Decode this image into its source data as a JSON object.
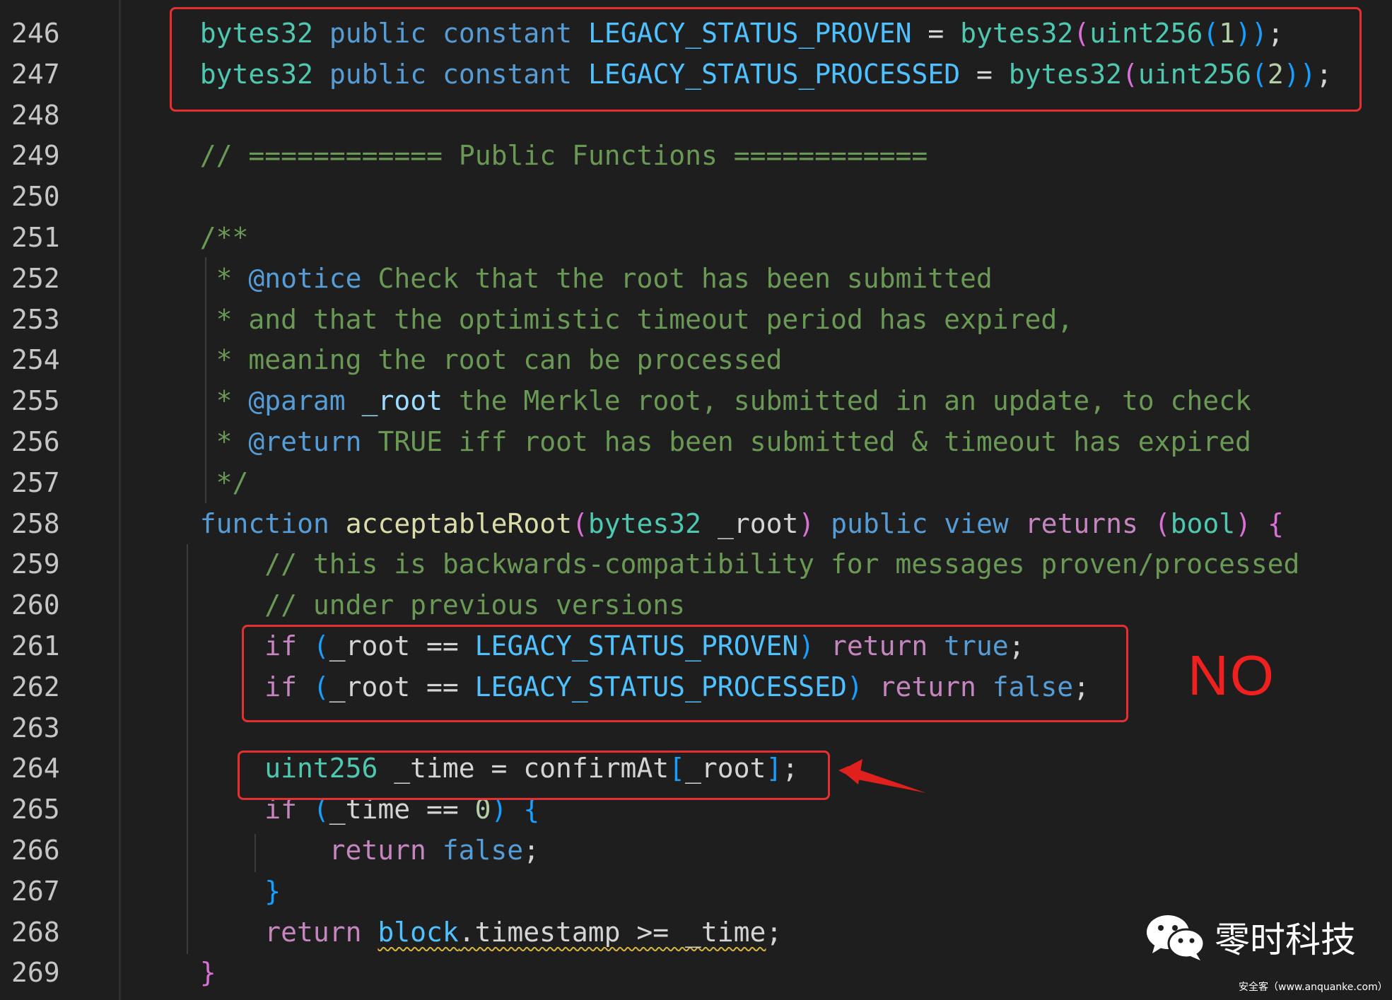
{
  "editor": {
    "lines": [
      {
        "num": "246",
        "indent": 8,
        "guide": false,
        "tokens": [
          [
            "bytes32",
            "#4ec9b0"
          ],
          [
            " ",
            "#d4d4d4"
          ],
          [
            "public",
            "#569cd6"
          ],
          [
            " ",
            "#d4d4d4"
          ],
          [
            "constant",
            "#569cd6"
          ],
          [
            " ",
            "#d4d4d4"
          ],
          [
            "LEGACY_STATUS_PROVEN",
            "#4fc1ff"
          ],
          [
            " = ",
            "#d4d4d4"
          ],
          [
            "bytes32",
            "#4ec9b0"
          ],
          [
            "(",
            "#da70d6"
          ],
          [
            "uint256",
            "#4ec9b0"
          ],
          [
            "(",
            "#179fff"
          ],
          [
            "1",
            "#b5cea8"
          ],
          [
            "))",
            "#179fff"
          ],
          [
            ";",
            "#d4d4d4"
          ]
        ]
      },
      {
        "num": "247",
        "indent": 8,
        "guide": false,
        "tokens": [
          [
            "bytes32",
            "#4ec9b0"
          ],
          [
            " ",
            "#d4d4d4"
          ],
          [
            "public",
            "#569cd6"
          ],
          [
            " ",
            "#d4d4d4"
          ],
          [
            "constant",
            "#569cd6"
          ],
          [
            " ",
            "#d4d4d4"
          ],
          [
            "LEGACY_STATUS_PROCESSED",
            "#4fc1ff"
          ],
          [
            " = ",
            "#d4d4d4"
          ],
          [
            "bytes32",
            "#4ec9b0"
          ],
          [
            "(",
            "#da70d6"
          ],
          [
            "uint256",
            "#4ec9b0"
          ],
          [
            "(",
            "#179fff"
          ],
          [
            "2",
            "#b5cea8"
          ],
          [
            "))",
            "#179fff"
          ],
          [
            ";",
            "#d4d4d4"
          ]
        ]
      },
      {
        "num": "248",
        "indent": 8,
        "guide": false,
        "tokens": []
      },
      {
        "num": "249",
        "indent": 8,
        "guide": false,
        "tokens": [
          [
            "// ============ Public Functions ============",
            "#6a9955"
          ]
        ]
      },
      {
        "num": "250",
        "indent": 8,
        "guide": false,
        "tokens": []
      },
      {
        "num": "251",
        "indent": 8,
        "guide": false,
        "tokens": [
          [
            "/**",
            "#6a9955"
          ]
        ]
      },
      {
        "num": "252",
        "indent": 9,
        "guide": false,
        "tokens": [
          [
            "* ",
            "#6a9955"
          ],
          [
            "@notice",
            "#569cd6"
          ],
          [
            " Check that the root has been submitted",
            "#6a9955"
          ]
        ]
      },
      {
        "num": "253",
        "indent": 9,
        "guide": false,
        "tokens": [
          [
            "* and that the optimistic timeout period has expired,",
            "#6a9955"
          ]
        ]
      },
      {
        "num": "254",
        "indent": 9,
        "guide": false,
        "tokens": [
          [
            "* meaning the root can be processed",
            "#6a9955"
          ]
        ]
      },
      {
        "num": "255",
        "indent": 9,
        "guide": false,
        "tokens": [
          [
            "* ",
            "#6a9955"
          ],
          [
            "@param",
            "#569cd6"
          ],
          [
            " ",
            "#6a9955"
          ],
          [
            "_root",
            "#9cdcfe"
          ],
          [
            " the Merkle root, submitted in an update, to check",
            "#6a9955"
          ]
        ]
      },
      {
        "num": "256",
        "indent": 9,
        "guide": false,
        "tokens": [
          [
            "* ",
            "#6a9955"
          ],
          [
            "@return",
            "#569cd6"
          ],
          [
            " TRUE iff root has been submitted & timeout has expired",
            "#6a9955"
          ]
        ]
      },
      {
        "num": "257",
        "indent": 9,
        "guide": false,
        "tokens": [
          [
            "*/",
            "#6a9955"
          ]
        ]
      },
      {
        "num": "258",
        "indent": 8,
        "guide": false,
        "tokens": [
          [
            "function",
            "#569cd6"
          ],
          [
            " ",
            "#d4d4d4"
          ],
          [
            "acceptableRoot",
            "#dcdcaa"
          ],
          [
            "(",
            "#da70d6"
          ],
          [
            "bytes32",
            "#4ec9b0"
          ],
          [
            " _root",
            "#d4d4d4"
          ],
          [
            ")",
            "#da70d6"
          ],
          [
            " ",
            "#d4d4d4"
          ],
          [
            "public",
            "#569cd6"
          ],
          [
            " ",
            "#d4d4d4"
          ],
          [
            "view",
            "#569cd6"
          ],
          [
            " ",
            "#d4d4d4"
          ],
          [
            "returns",
            "#c586c0"
          ],
          [
            " ",
            "#d4d4d4"
          ],
          [
            "(",
            "#da70d6"
          ],
          [
            "bool",
            "#4ec9b0"
          ],
          [
            ")",
            "#da70d6"
          ],
          [
            " ",
            "#d4d4d4"
          ],
          [
            "{",
            "#da70d6"
          ]
        ]
      },
      {
        "num": "259",
        "indent": 12,
        "guide": true,
        "tokens": [
          [
            "// this is backwards-compatibility for messages proven/processed",
            "#6a9955"
          ]
        ]
      },
      {
        "num": "260",
        "indent": 12,
        "guide": true,
        "tokens": [
          [
            "// under previous versions",
            "#6a9955"
          ]
        ]
      },
      {
        "num": "261",
        "indent": 12,
        "guide": true,
        "tokens": [
          [
            "if",
            "#c586c0"
          ],
          [
            " ",
            "#d4d4d4"
          ],
          [
            "(",
            "#179fff"
          ],
          [
            "_root == ",
            "#d4d4d4"
          ],
          [
            "LEGACY_STATUS_PROVEN",
            "#4fc1ff"
          ],
          [
            ")",
            "#179fff"
          ],
          [
            " ",
            "#d4d4d4"
          ],
          [
            "return",
            "#c586c0"
          ],
          [
            " ",
            "#d4d4d4"
          ],
          [
            "true",
            "#569cd6"
          ],
          [
            ";",
            "#d4d4d4"
          ]
        ]
      },
      {
        "num": "262",
        "indent": 12,
        "guide": true,
        "tokens": [
          [
            "if",
            "#c586c0"
          ],
          [
            " ",
            "#d4d4d4"
          ],
          [
            "(",
            "#179fff"
          ],
          [
            "_root == ",
            "#d4d4d4"
          ],
          [
            "LEGACY_STATUS_PROCESSED",
            "#4fc1ff"
          ],
          [
            ")",
            "#179fff"
          ],
          [
            " ",
            "#d4d4d4"
          ],
          [
            "return",
            "#c586c0"
          ],
          [
            " ",
            "#d4d4d4"
          ],
          [
            "false",
            "#569cd6"
          ],
          [
            ";",
            "#d4d4d4"
          ]
        ]
      },
      {
        "num": "263",
        "indent": 12,
        "guide": true,
        "tokens": []
      },
      {
        "num": "264",
        "indent": 12,
        "guide": true,
        "tokens": [
          [
            "uint256",
            "#4ec9b0"
          ],
          [
            " _time = ",
            "#d4d4d4"
          ],
          [
            "confirmAt",
            "#d4d4d4"
          ],
          [
            "[",
            "#179fff"
          ],
          [
            "_root",
            "#d4d4d4"
          ],
          [
            "]",
            "#179fff"
          ],
          [
            ";",
            "#d4d4d4"
          ]
        ]
      },
      {
        "num": "265",
        "indent": 12,
        "guide": true,
        "tokens": [
          [
            "if",
            "#c586c0"
          ],
          [
            " ",
            "#d4d4d4"
          ],
          [
            "(",
            "#179fff"
          ],
          [
            "_time == ",
            "#d4d4d4"
          ],
          [
            "0",
            "#b5cea8"
          ],
          [
            ")",
            "#179fff"
          ],
          [
            " ",
            "#d4d4d4"
          ],
          [
            "{",
            "#179fff"
          ]
        ]
      },
      {
        "num": "266",
        "indent": 16,
        "guide": true,
        "tokens": [
          [
            "return",
            "#c586c0"
          ],
          [
            " ",
            "#d4d4d4"
          ],
          [
            "false",
            "#569cd6"
          ],
          [
            ";",
            "#d4d4d4"
          ]
        ]
      },
      {
        "num": "267",
        "indent": 12,
        "guide": true,
        "tokens": [
          [
            "}",
            "#179fff"
          ]
        ]
      },
      {
        "num": "268",
        "indent": 12,
        "guide": true,
        "tokens": [
          [
            "return",
            "#c586c0"
          ],
          [
            " ",
            "#d4d4d4"
          ],
          [
            "block",
            "#4fc1ff",
            "squiggle"
          ],
          [
            ".timestamp >= _time",
            "#d4d4d4",
            "squiggle"
          ],
          [
            ";",
            "#d4d4d4"
          ]
        ]
      },
      {
        "num": "269",
        "indent": 8,
        "guide": false,
        "tokens": [
          [
            "}",
            "#da70d6"
          ]
        ]
      }
    ]
  },
  "annotations": {
    "no_label": "NO"
  },
  "watermark": {
    "brand": "零时科技",
    "source": "安全客（www.anquanke.com）"
  }
}
